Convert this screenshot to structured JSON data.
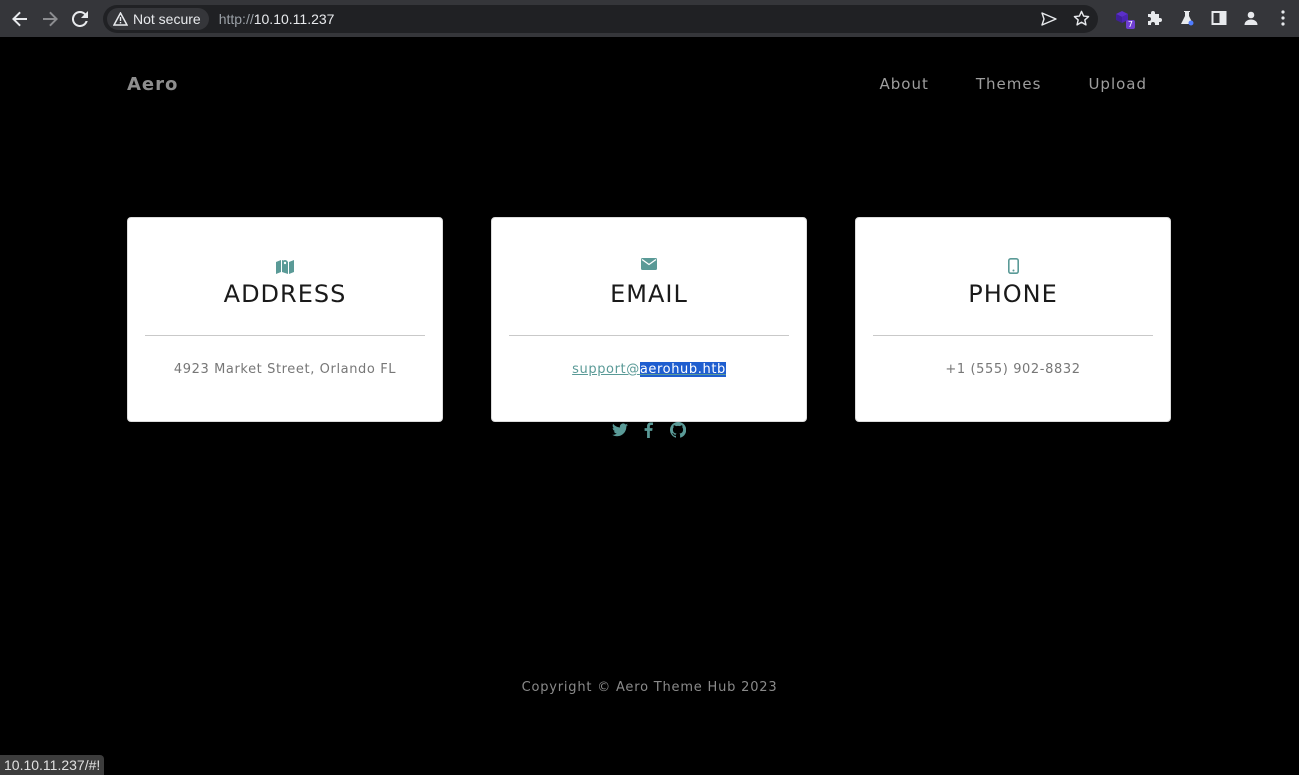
{
  "browser": {
    "security_label": "Not secure",
    "url_scheme": "http://",
    "url_host": "10.10.11.237",
    "extension_badge": "7",
    "status_url": "10.10.11.237/#!"
  },
  "site": {
    "brand": "Aero",
    "nav": [
      "About",
      "Themes",
      "Upload"
    ]
  },
  "cards": [
    {
      "title": "ADDRESS",
      "text": "4923 Market Street, Orlando FL",
      "icon": "map-icon"
    },
    {
      "title": "EMAIL",
      "email_prefix": "support@",
      "email_selected": "aerohub.htb",
      "icon": "envelope-icon"
    },
    {
      "title": "PHONE",
      "text": "+1 (555) 902-8832",
      "icon": "mobile-icon"
    }
  ],
  "socials": [
    "twitter-icon",
    "facebook-icon",
    "github-icon"
  ],
  "footer": {
    "copyright": "Copyright © Aero Theme Hub 2023"
  },
  "colors": {
    "accent": "#5a9a97",
    "selection": "#1f5ecf",
    "background": "#000000"
  }
}
